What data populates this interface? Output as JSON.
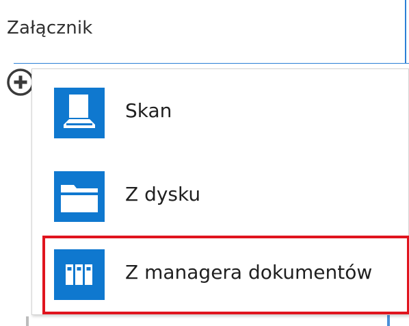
{
  "field": {
    "label": "Załącznik"
  },
  "add_button": {
    "icon": "plus-circle-icon"
  },
  "menu": {
    "items": [
      {
        "label": "Skan",
        "icon": "scanner-icon"
      },
      {
        "label": "Z dysku",
        "icon": "folder-icon"
      },
      {
        "label": "Z managera dokumentów",
        "icon": "binders-icon"
      }
    ]
  },
  "colors": {
    "tile_blue": "#0f78cf",
    "accent_blue": "#2b7fd6",
    "highlight_red": "#e0141e"
  }
}
